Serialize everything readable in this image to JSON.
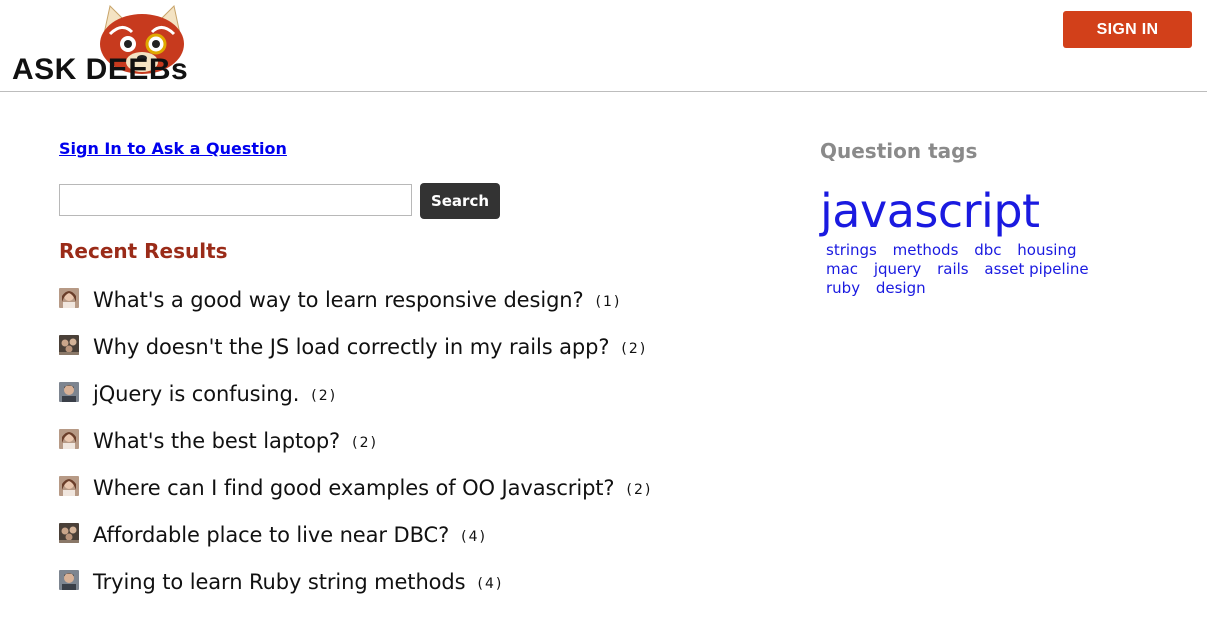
{
  "header": {
    "logo_text": "ASK DEEBs",
    "signin_label": "SIGN IN"
  },
  "main": {
    "ask_link": "Sign In to Ask a Question",
    "search": {
      "value": "",
      "placeholder": "",
      "button_label": "Search"
    },
    "recent_heading": "Recent Results",
    "results": [
      {
        "title": "What's a good way to learn responsive design?",
        "count": "(1)",
        "avatar": "avatar-woman"
      },
      {
        "title": "Why doesn't the JS load correctly in my rails app?",
        "count": "(2)",
        "avatar": "avatar-group"
      },
      {
        "title": "jQuery is confusing.",
        "count": "(2)",
        "avatar": "avatar-man"
      },
      {
        "title": "What's the best laptop?",
        "count": "(2)",
        "avatar": "avatar-woman"
      },
      {
        "title": "Where can I find good examples of OO Javascript?",
        "count": "(2)",
        "avatar": "avatar-woman"
      },
      {
        "title": "Affordable place to live near DBC?",
        "count": "(4)",
        "avatar": "avatar-group"
      },
      {
        "title": "Trying to learn Ruby string methods",
        "count": "(4)",
        "avatar": "avatar-man"
      }
    ]
  },
  "sidebar": {
    "heading": "Question tags",
    "featured_tag": "javascript",
    "tags": [
      "strings",
      "methods",
      "dbc",
      "housing",
      "mac",
      "jquery",
      "rails",
      "asset pipeline",
      "ruby",
      "design"
    ]
  },
  "colors": {
    "signin_button": "#d2401a",
    "search_button": "#333333",
    "recent_heading": "#9a2b18",
    "tags_heading": "#8a8a8a",
    "tag_link": "#1a1ae0"
  }
}
